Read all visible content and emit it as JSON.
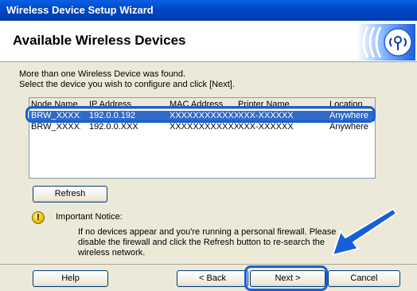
{
  "window": {
    "title": "Wireless Device Setup Wizard"
  },
  "header": {
    "title": "Available Wireless Devices",
    "logo_icon": "wifi-logo-icon"
  },
  "intro": {
    "line1": "More than one Wireless Device was found.",
    "line2": "Select the device you wish to configure and click [Next]."
  },
  "table": {
    "columns": [
      "Node Name",
      "IP Address",
      "MAC Address",
      "Printer Name",
      "Location"
    ],
    "rows": [
      {
        "node": "BRW_XXXXXX",
        "ip": "192.0.0.192",
        "mac": "XXXXXXXXXXXX",
        "printer": "XXX-XXXXXX",
        "location": "Anywhere",
        "selected": true
      },
      {
        "node": "BRW_XXXXXX",
        "ip": "192.0.0.XXX",
        "mac": "XXXXXXXXXXXX",
        "printer": "XXX-XXXXXX",
        "location": "Anywhere",
        "selected": false
      }
    ]
  },
  "buttons": {
    "refresh": "Refresh",
    "help": "Help",
    "back": "< Back",
    "next": "Next >",
    "cancel": "Cancel"
  },
  "notice": {
    "title": "Important Notice:",
    "line1": "If no devices appear and you're running a personal firewall. Please",
    "line2": "disable the firewall and click the Refresh button to re-search the",
    "line3": "wireless network."
  },
  "colors": {
    "accent": "#1560d8",
    "selection": "#316ac5",
    "titlebar": "#0049c7"
  }
}
